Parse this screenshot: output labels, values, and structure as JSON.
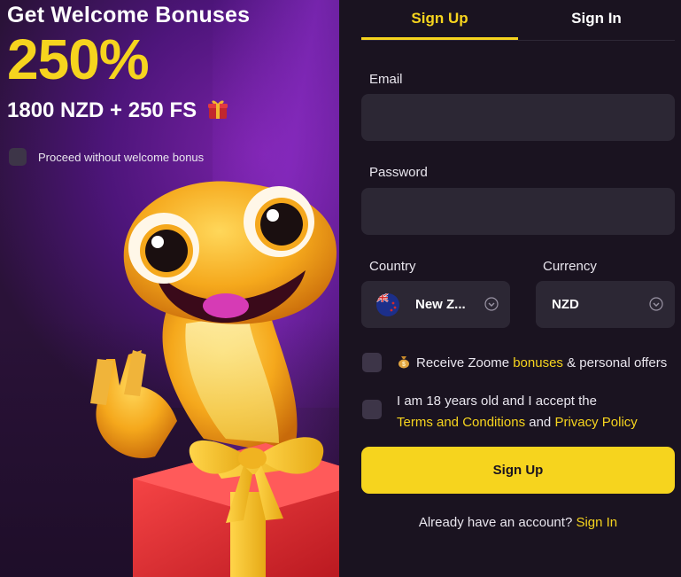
{
  "promo": {
    "title": "Get Welcome Bonuses",
    "percent": "250%",
    "amount": "1800 NZD + 250 FS",
    "no_bonus_label": "Proceed without welcome bonus"
  },
  "tabs": [
    {
      "label": "Sign Up",
      "active": true
    },
    {
      "label": "Sign In",
      "active": false
    }
  ],
  "form": {
    "email_label": "Email",
    "email_value": "",
    "password_label": "Password",
    "password_value": "",
    "country_label": "Country",
    "country_value": "New Z...",
    "currency_label": "Currency",
    "currency_value": "NZD",
    "offers_prefix": "Receive Zoome ",
    "offers_link": "bonuses",
    "offers_suffix": " & personal offers",
    "terms_prefix": "I am 18 years old and I accept the",
    "terms_link": "Terms and Conditions",
    "terms_and": " and ",
    "privacy_link": "Privacy Policy",
    "submit_label": "Sign Up",
    "already_text": "Already have an account? ",
    "signin_link": "Sign In"
  },
  "colors": {
    "accent": "#f6d41e",
    "panel_bg": "#1a1320",
    "field_bg": "#2c2734",
    "promo_bg": "#2a1238"
  },
  "icons": [
    "gift-icon",
    "nz-flag-icon",
    "chevron-down-icon",
    "money-bag-icon",
    "mascot-image"
  ]
}
